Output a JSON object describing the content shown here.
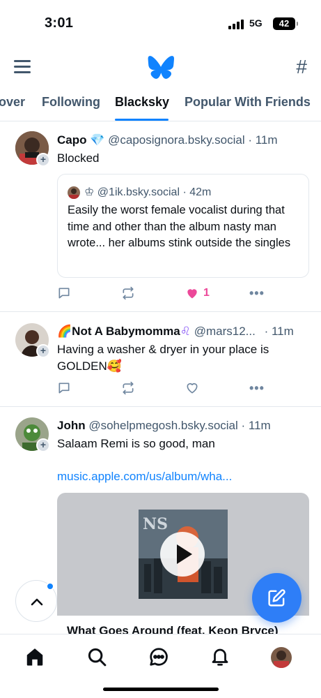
{
  "status_bar": {
    "time": "3:01",
    "network": "5G",
    "battery": "42"
  },
  "header": {
    "menu_icon": "hamburger-menu-icon",
    "logo": "butterfly-logo",
    "feeds_icon": "hashtag-icon"
  },
  "tabs": [
    {
      "label": "over",
      "active": false
    },
    {
      "label": "Following",
      "active": false
    },
    {
      "label": "Blacksky",
      "active": true
    },
    {
      "label": "Popular With Friends",
      "active": false
    }
  ],
  "posts": [
    {
      "name": "Capo",
      "name_emoji": "💎",
      "handle": "@caposignora.bsky.social",
      "time": "· 11m",
      "text": "Blocked",
      "quote": {
        "crown": "♔",
        "handle": "@1ik.bsky.social",
        "time": "· 42m",
        "text": "Easily the worst female vocalist during that time and other than the album nasty man wrote...  her albums stink outside the singles"
      },
      "like_count": "1",
      "liked": true
    },
    {
      "name_prefix": "🌈",
      "name": "Not A Babymomma",
      "name_emoji": "♌",
      "handle": "@mars12...",
      "time": "· 11m",
      "text": "Having a washer & dryer in your place is GOLDEN🥰",
      "like_count": "",
      "liked": false
    },
    {
      "name": "John",
      "handle": "@sohelpmegosh.bsky.social",
      "time": "· 11m",
      "text": "Salaam Remi is so good, man",
      "link": "music.apple.com/us/album/wha...",
      "embed_title": "What Goes Around (feat. Keon Bryce)"
    }
  ],
  "colors": {
    "accent": "#1083fe",
    "like": "#ec4899",
    "muted": "#42576c"
  }
}
